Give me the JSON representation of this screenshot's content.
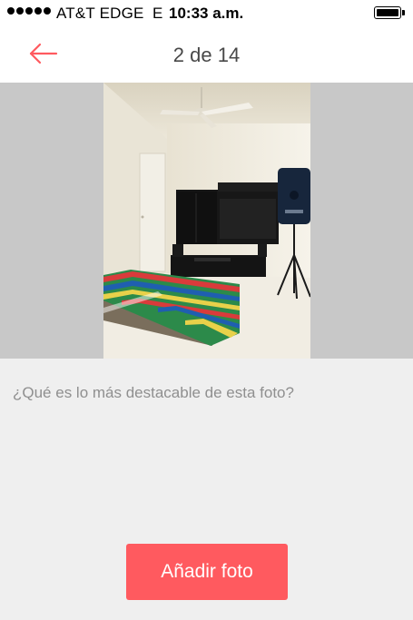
{
  "status_bar": {
    "carrier": "AT&T EDGE",
    "network": "E",
    "time": "10:33 a.m.",
    "signal_bars": 5,
    "battery_level": 0.9
  },
  "nav": {
    "title": "2 de 14",
    "back_icon": "arrow-left-icon",
    "accent_color": "#ff5a5f"
  },
  "photo": {
    "subject": "room-photo"
  },
  "caption": {
    "placeholder": "¿Qué es lo más destacable de esta foto?",
    "value": ""
  },
  "actions": {
    "add_photo_label": "Añadir foto"
  }
}
